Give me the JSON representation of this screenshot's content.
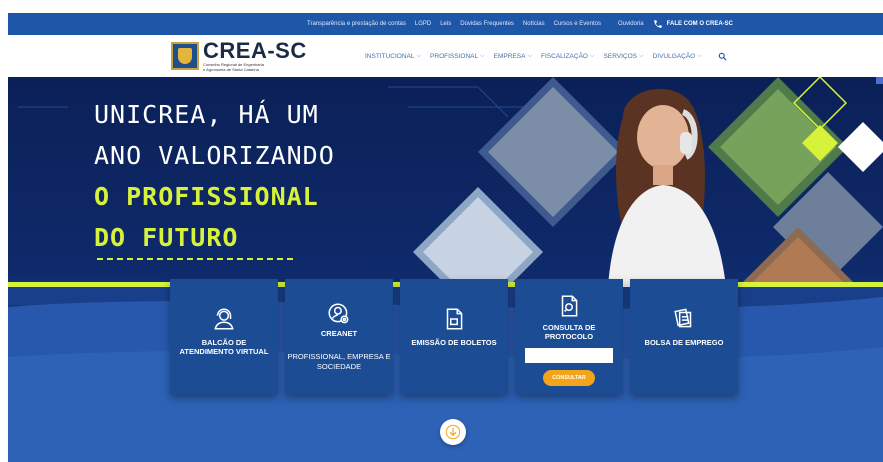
{
  "topbar": {
    "links": [
      "Transparência e prestação de contas",
      "LGPD",
      "Leis",
      "Dúvidas Frequentes",
      "Notícias",
      "Cursos e Eventos"
    ],
    "ouvidoria": "Ouvidoria",
    "fale": "FALE COM O CREA-SC",
    "phone_icon": "phone-icon"
  },
  "header": {
    "logo_title": "CREA-SC",
    "logo_subtitle_1": "Conselho Regional de Engenharia",
    "logo_subtitle_2": "e Agronomia de Santa Catarina",
    "nav": [
      "INSTITUCIONAL",
      "PROFISSIONAL",
      "EMPRESA",
      "FISCALIZAÇÃO",
      "SERVIÇOS",
      "DIVULGAÇÃO"
    ],
    "search_icon": "search-icon"
  },
  "hero": {
    "line1": "UNICREA, HÁ UM",
    "line2": "ANO VALORIZANDO",
    "line3": "O PROFISSIONAL",
    "line4": "DO FUTURO"
  },
  "cards": {
    "balcao": {
      "title": "BALCÃO DE ATENDIMENTO VIRTUAL",
      "icon": "headset-user-icon"
    },
    "creanet": {
      "title": "CREANET",
      "subtitle": "PROFISSIONAL, EMPRESA E SOCIEDADE",
      "icon": "user-gear-icon"
    },
    "boletos": {
      "title": "EMISSÃO DE BOLETOS",
      "icon": "document-icon"
    },
    "protocolo": {
      "title": "CONSULTA DE PROTOCOLO",
      "input_value": "",
      "button": "CONSULTAR",
      "icon": "document-search-icon"
    },
    "emprego": {
      "title": "BOLSA DE EMPREGO",
      "icon": "briefcase-documents-icon"
    }
  },
  "colors": {
    "topbar": "#1f57a8",
    "accent_green": "#d6f23a",
    "card": "#1c4c93",
    "button": "#f2a51b"
  },
  "scroll_icon": "arrow-down-icon"
}
